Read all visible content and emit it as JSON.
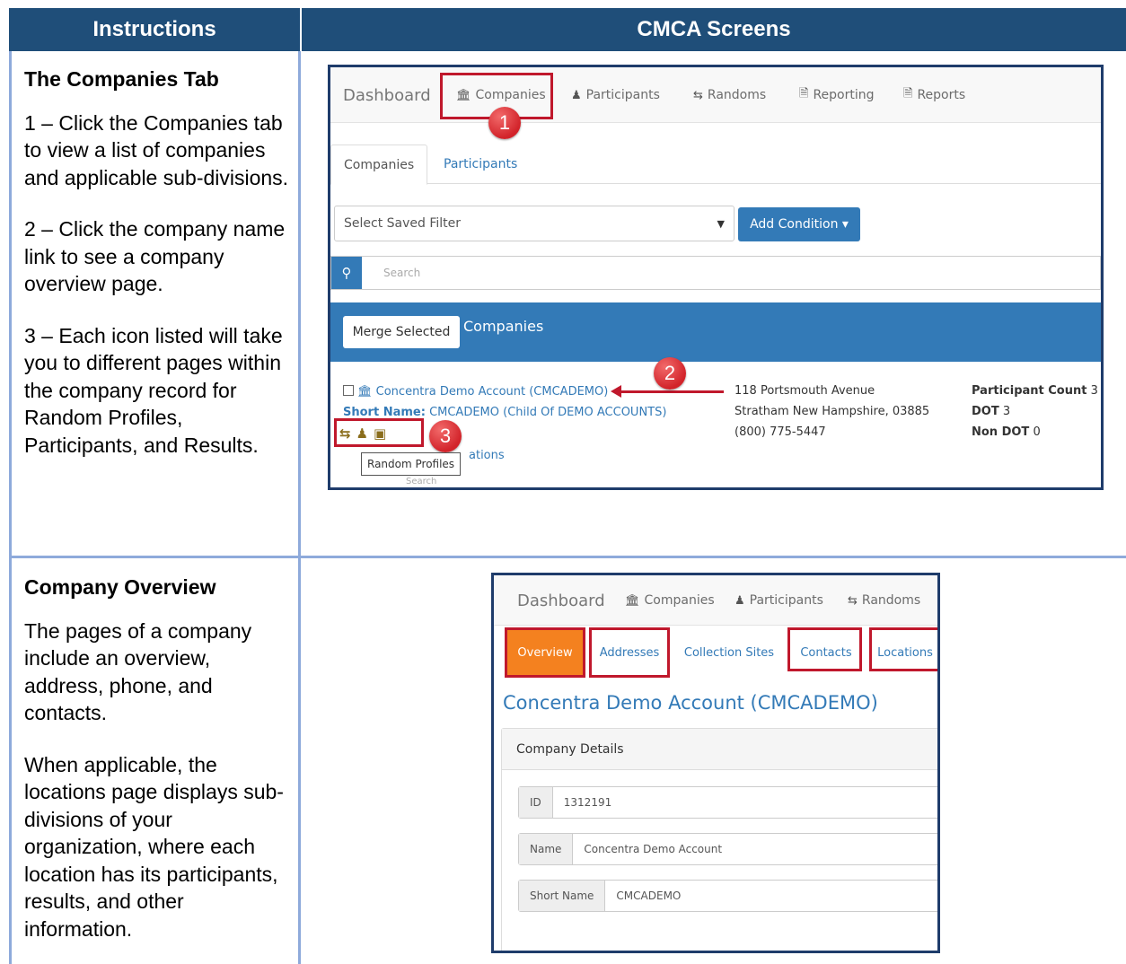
{
  "header": {
    "left": "Instructions",
    "right": "CMCA Screens"
  },
  "section1": {
    "title": "The Companies Tab",
    "paragraphs": [
      "1 – Click the Companies tab to view a list of companies and applicable sub-divisions.",
      "2 – Click the company name link to see a company overview page.",
      "3 – Each icon listed will take you to different pages within the company record for Random Profiles, Participants, and Results."
    ]
  },
  "section2": {
    "title": "Company Overview",
    "paragraphs": [
      "The pages of a company include an overview, address, phone, and contacts.",
      "When applicable, the locations page displays sub-divisions of your organization, where each location has its participants, results, and other information."
    ]
  },
  "shot1": {
    "nav": {
      "brand": "Dashboard",
      "companies": "Companies",
      "participants": "Participants",
      "randoms": "Randoms",
      "reporting": "Reporting",
      "reports": "Reports"
    },
    "markers": [
      "1",
      "2",
      "3"
    ],
    "subtabs": {
      "companies": "Companies",
      "participants": "Participants"
    },
    "filter_placeholder": "Select Saved Filter",
    "add_condition": "Add Condition ▾",
    "search_placeholder": "Search",
    "merge_selected": "Merge Selected",
    "panel_title": "Companies",
    "row": {
      "company_link": "Concentra Demo Account (CMCADEMO)",
      "short_name_label": "Short Name:",
      "short_name_value": "CMCADEMO (Child Of DEMO ACCOUNTS)",
      "address1": "118 Portsmouth Avenue",
      "address2": "Stratham New Hampshire, 03885",
      "phone": "(800) 775-5447",
      "participant_count_label": "Participant Count",
      "participant_count_value": "3",
      "dot_label": "DOT",
      "dot_value": "3",
      "non_dot_label": "Non DOT",
      "non_dot_value": "0",
      "partial_link": "ations",
      "partial_search": "Search"
    },
    "tooltip": "Random Profiles"
  },
  "shot2": {
    "nav": {
      "brand": "Dashboard",
      "companies": "Companies",
      "participants": "Participants",
      "randoms": "Randoms"
    },
    "tabs": {
      "overview": "Overview",
      "addresses": "Addresses",
      "collection_sites": "Collection Sites",
      "contacts": "Contacts",
      "locations": "Locations"
    },
    "company_title": "Concentra Demo Account (CMCADEMO)",
    "details_header": "Company Details",
    "fields": {
      "id_label": "ID",
      "id_value": "1312191",
      "name_label": "Name",
      "name_value": "Concentra Demo Account",
      "short_name_label": "Short Name",
      "short_name_value": "CMCADEMO"
    }
  },
  "colors": {
    "header_bg": "#1f4e79",
    "border": "#8eaadb",
    "highlight": "#c0182c",
    "primary": "#337ab7",
    "active_tab": "#f4811f"
  },
  "icons": [
    "bank-icon",
    "users-icon",
    "retweet-icon",
    "file-icon",
    "search-icon",
    "caret-down-icon",
    "inbox-icon"
  ]
}
